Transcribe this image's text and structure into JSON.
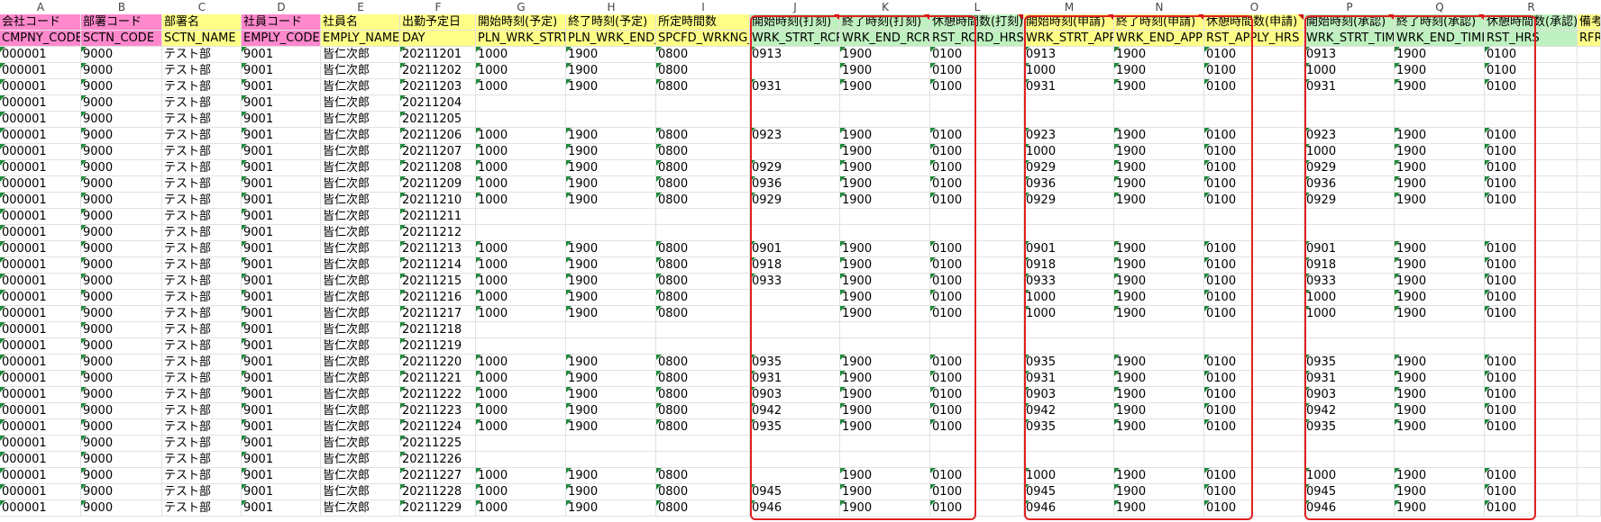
{
  "column_letters": [
    "A",
    "B",
    "C",
    "D",
    "E",
    "F",
    "G",
    "H",
    "I",
    "J",
    "K",
    "L",
    "M",
    "N",
    "O",
    "P",
    "Q",
    "R"
  ],
  "header_jp": [
    "会社コード",
    "部署コード",
    "部署名",
    "社員コード",
    "社員名",
    "出勤予定日",
    "開始時刻(予定)",
    "終了時刻(予定)",
    "所定時間数",
    "開始時刻(打刻)",
    "終了時刻(打刻)",
    "休憩時間数(打刻)",
    "開始時刻(申請)",
    "終了時刻(申請)",
    "休憩時間数(申請)",
    "開始時刻(承認)",
    "終了時刻(承認)",
    "休憩時間数(承認)",
    "備考"
  ],
  "header_en": [
    "CMPNY_CODE",
    "SCTN_CODE",
    "SCTN_NAME",
    "EMPLY_CODE",
    "EMPLY_NAME",
    "DAY",
    "PLN_WRK_STRT_",
    "PLN_WRK_END_T",
    "SPCFD_WRKNG_",
    "WRK_STRT_RCRD",
    "WRK_END_RCRD",
    "RST_RCRD_HRS",
    "WRK_STRT_APPL",
    "WRK_END_APPL",
    "RST_APPLY_HRS",
    "WRK_STRT_TIME",
    "WRK_END_TIME",
    "RST_HRS",
    "RFR"
  ],
  "header_colors": [
    "#ff88cc",
    "#ff88cc",
    "#ffff88",
    "#ff88cc",
    "#ffff88",
    "#ffff88",
    "#ffff88",
    "#ffff88",
    "#ffff88",
    "#bff0bf",
    "#bff0bf",
    "#bff0bf",
    "#ffff88",
    "#ffff88",
    "#ffff88",
    "#bff0bf",
    "#bff0bf",
    "#bff0bf",
    "#ffff88"
  ],
  "common": {
    "company": "000001",
    "dept_code": "9000",
    "dept_name": "テスト部",
    "emp_code": "9001",
    "emp_name": "皆仁次郎"
  },
  "rows": [
    {
      "day": "20211201",
      "pln_s": "1000",
      "pln_e": "1900",
      "spcfd": "0800",
      "rec_s": "0913",
      "rec_e": "1900",
      "rec_r": "0100",
      "app_s": "0913",
      "app_e": "1900",
      "app_r": "0100",
      "apr_s": "0913",
      "apr_e": "1900",
      "apr_r": "0100"
    },
    {
      "day": "20211202",
      "pln_s": "1000",
      "pln_e": "1900",
      "spcfd": "0800",
      "rec_s": "",
      "rec_e": "1900",
      "rec_r": "0100",
      "app_s": "1000",
      "app_e": "1900",
      "app_r": "0100",
      "apr_s": "1000",
      "apr_e": "1900",
      "apr_r": "0100"
    },
    {
      "day": "20211203",
      "pln_s": "1000",
      "pln_e": "1900",
      "spcfd": "0800",
      "rec_s": "0931",
      "rec_e": "1900",
      "rec_r": "0100",
      "app_s": "0931",
      "app_e": "1900",
      "app_r": "0100",
      "apr_s": "0931",
      "apr_e": "1900",
      "apr_r": "0100"
    },
    {
      "day": "20211204",
      "pln_s": "",
      "pln_e": "",
      "spcfd": "",
      "rec_s": "",
      "rec_e": "",
      "rec_r": "",
      "app_s": "",
      "app_e": "",
      "app_r": "",
      "apr_s": "",
      "apr_e": "",
      "apr_r": ""
    },
    {
      "day": "20211205",
      "pln_s": "",
      "pln_e": "",
      "spcfd": "",
      "rec_s": "",
      "rec_e": "",
      "rec_r": "",
      "app_s": "",
      "app_e": "",
      "app_r": "",
      "apr_s": "",
      "apr_e": "",
      "apr_r": ""
    },
    {
      "day": "20211206",
      "pln_s": "1000",
      "pln_e": "1900",
      "spcfd": "0800",
      "rec_s": "0923",
      "rec_e": "1900",
      "rec_r": "0100",
      "app_s": "0923",
      "app_e": "1900",
      "app_r": "0100",
      "apr_s": "0923",
      "apr_e": "1900",
      "apr_r": "0100"
    },
    {
      "day": "20211207",
      "pln_s": "1000",
      "pln_e": "1900",
      "spcfd": "0800",
      "rec_s": "",
      "rec_e": "1900",
      "rec_r": "0100",
      "app_s": "1000",
      "app_e": "1900",
      "app_r": "0100",
      "apr_s": "1000",
      "apr_e": "1900",
      "apr_r": "0100"
    },
    {
      "day": "20211208",
      "pln_s": "1000",
      "pln_e": "1900",
      "spcfd": "0800",
      "rec_s": "0929",
      "rec_e": "1900",
      "rec_r": "0100",
      "app_s": "0929",
      "app_e": "1900",
      "app_r": "0100",
      "apr_s": "0929",
      "apr_e": "1900",
      "apr_r": "0100"
    },
    {
      "day": "20211209",
      "pln_s": "1000",
      "pln_e": "1900",
      "spcfd": "0800",
      "rec_s": "0936",
      "rec_e": "1900",
      "rec_r": "0100",
      "app_s": "0936",
      "app_e": "1900",
      "app_r": "0100",
      "apr_s": "0936",
      "apr_e": "1900",
      "apr_r": "0100"
    },
    {
      "day": "20211210",
      "pln_s": "1000",
      "pln_e": "1900",
      "spcfd": "0800",
      "rec_s": "0929",
      "rec_e": "1900",
      "rec_r": "0100",
      "app_s": "0929",
      "app_e": "1900",
      "app_r": "0100",
      "apr_s": "0929",
      "apr_e": "1900",
      "apr_r": "0100"
    },
    {
      "day": "20211211",
      "pln_s": "",
      "pln_e": "",
      "spcfd": "",
      "rec_s": "",
      "rec_e": "",
      "rec_r": "",
      "app_s": "",
      "app_e": "",
      "app_r": "",
      "apr_s": "",
      "apr_e": "",
      "apr_r": ""
    },
    {
      "day": "20211212",
      "pln_s": "",
      "pln_e": "",
      "spcfd": "",
      "rec_s": "",
      "rec_e": "",
      "rec_r": "",
      "app_s": "",
      "app_e": "",
      "app_r": "",
      "apr_s": "",
      "apr_e": "",
      "apr_r": ""
    },
    {
      "day": "20211213",
      "pln_s": "1000",
      "pln_e": "1900",
      "spcfd": "0800",
      "rec_s": "0901",
      "rec_e": "1900",
      "rec_r": "0100",
      "app_s": "0901",
      "app_e": "1900",
      "app_r": "0100",
      "apr_s": "0901",
      "apr_e": "1900",
      "apr_r": "0100"
    },
    {
      "day": "20211214",
      "pln_s": "1000",
      "pln_e": "1900",
      "spcfd": "0800",
      "rec_s": "0918",
      "rec_e": "1900",
      "rec_r": "0100",
      "app_s": "0918",
      "app_e": "1900",
      "app_r": "0100",
      "apr_s": "0918",
      "apr_e": "1900",
      "apr_r": "0100"
    },
    {
      "day": "20211215",
      "pln_s": "1000",
      "pln_e": "1900",
      "spcfd": "0800",
      "rec_s": "0933",
      "rec_e": "1900",
      "rec_r": "0100",
      "app_s": "0933",
      "app_e": "1900",
      "app_r": "0100",
      "apr_s": "0933",
      "apr_e": "1900",
      "apr_r": "0100"
    },
    {
      "day": "20211216",
      "pln_s": "1000",
      "pln_e": "1900",
      "spcfd": "0800",
      "rec_s": "",
      "rec_e": "1900",
      "rec_r": "0100",
      "app_s": "1000",
      "app_e": "1900",
      "app_r": "0100",
      "apr_s": "1000",
      "apr_e": "1900",
      "apr_r": "0100"
    },
    {
      "day": "20211217",
      "pln_s": "1000",
      "pln_e": "1900",
      "spcfd": "0800",
      "rec_s": "",
      "rec_e": "1900",
      "rec_r": "0100",
      "app_s": "1000",
      "app_e": "1900",
      "app_r": "0100",
      "apr_s": "1000",
      "apr_e": "1900",
      "apr_r": "0100"
    },
    {
      "day": "20211218",
      "pln_s": "",
      "pln_e": "",
      "spcfd": "",
      "rec_s": "",
      "rec_e": "",
      "rec_r": "",
      "app_s": "",
      "app_e": "",
      "app_r": "",
      "apr_s": "",
      "apr_e": "",
      "apr_r": ""
    },
    {
      "day": "20211219",
      "pln_s": "",
      "pln_e": "",
      "spcfd": "",
      "rec_s": "",
      "rec_e": "",
      "rec_r": "",
      "app_s": "",
      "app_e": "",
      "app_r": "",
      "apr_s": "",
      "apr_e": "",
      "apr_r": ""
    },
    {
      "day": "20211220",
      "pln_s": "1000",
      "pln_e": "1900",
      "spcfd": "0800",
      "rec_s": "0935",
      "rec_e": "1900",
      "rec_r": "0100",
      "app_s": "0935",
      "app_e": "1900",
      "app_r": "0100",
      "apr_s": "0935",
      "apr_e": "1900",
      "apr_r": "0100"
    },
    {
      "day": "20211221",
      "pln_s": "1000",
      "pln_e": "1900",
      "spcfd": "0800",
      "rec_s": "0931",
      "rec_e": "1900",
      "rec_r": "0100",
      "app_s": "0931",
      "app_e": "1900",
      "app_r": "0100",
      "apr_s": "0931",
      "apr_e": "1900",
      "apr_r": "0100"
    },
    {
      "day": "20211222",
      "pln_s": "1000",
      "pln_e": "1900",
      "spcfd": "0800",
      "rec_s": "0903",
      "rec_e": "1900",
      "rec_r": "0100",
      "app_s": "0903",
      "app_e": "1900",
      "app_r": "0100",
      "apr_s": "0903",
      "apr_e": "1900",
      "apr_r": "0100"
    },
    {
      "day": "20211223",
      "pln_s": "1000",
      "pln_e": "1900",
      "spcfd": "0800",
      "rec_s": "0942",
      "rec_e": "1900",
      "rec_r": "0100",
      "app_s": "0942",
      "app_e": "1900",
      "app_r": "0100",
      "apr_s": "0942",
      "apr_e": "1900",
      "apr_r": "0100"
    },
    {
      "day": "20211224",
      "pln_s": "1000",
      "pln_e": "1900",
      "spcfd": "0800",
      "rec_s": "0935",
      "rec_e": "1900",
      "rec_r": "0100",
      "app_s": "0935",
      "app_e": "1900",
      "app_r": "0100",
      "apr_s": "0935",
      "apr_e": "1900",
      "apr_r": "0100"
    },
    {
      "day": "20211225",
      "pln_s": "",
      "pln_e": "",
      "spcfd": "",
      "rec_s": "",
      "rec_e": "",
      "rec_r": "",
      "app_s": "",
      "app_e": "",
      "app_r": "",
      "apr_s": "",
      "apr_e": "",
      "apr_r": ""
    },
    {
      "day": "20211226",
      "pln_s": "",
      "pln_e": "",
      "spcfd": "",
      "rec_s": "",
      "rec_e": "",
      "rec_r": "",
      "app_s": "",
      "app_e": "",
      "app_r": "",
      "apr_s": "",
      "apr_e": "",
      "apr_r": ""
    },
    {
      "day": "20211227",
      "pln_s": "1000",
      "pln_e": "1900",
      "spcfd": "0800",
      "rec_s": "",
      "rec_e": "1900",
      "rec_r": "0100",
      "app_s": "1000",
      "app_e": "1900",
      "app_r": "0100",
      "apr_s": "1000",
      "apr_e": "1900",
      "apr_r": "0100"
    },
    {
      "day": "20211228",
      "pln_s": "1000",
      "pln_e": "1900",
      "spcfd": "0800",
      "rec_s": "0945",
      "rec_e": "1900",
      "rec_r": "0100",
      "app_s": "0945",
      "app_e": "1900",
      "app_r": "0100",
      "apr_s": "0945",
      "apr_e": "1900",
      "apr_r": "0100"
    },
    {
      "day": "20211229",
      "pln_s": "1000",
      "pln_e": "1900",
      "spcfd": "0800",
      "rec_s": "0946",
      "rec_e": "1900",
      "rec_r": "0100",
      "app_s": "0946",
      "app_e": "1900",
      "app_r": "0100",
      "apr_s": "0946",
      "apr_e": "1900",
      "apr_r": "0100"
    }
  ]
}
